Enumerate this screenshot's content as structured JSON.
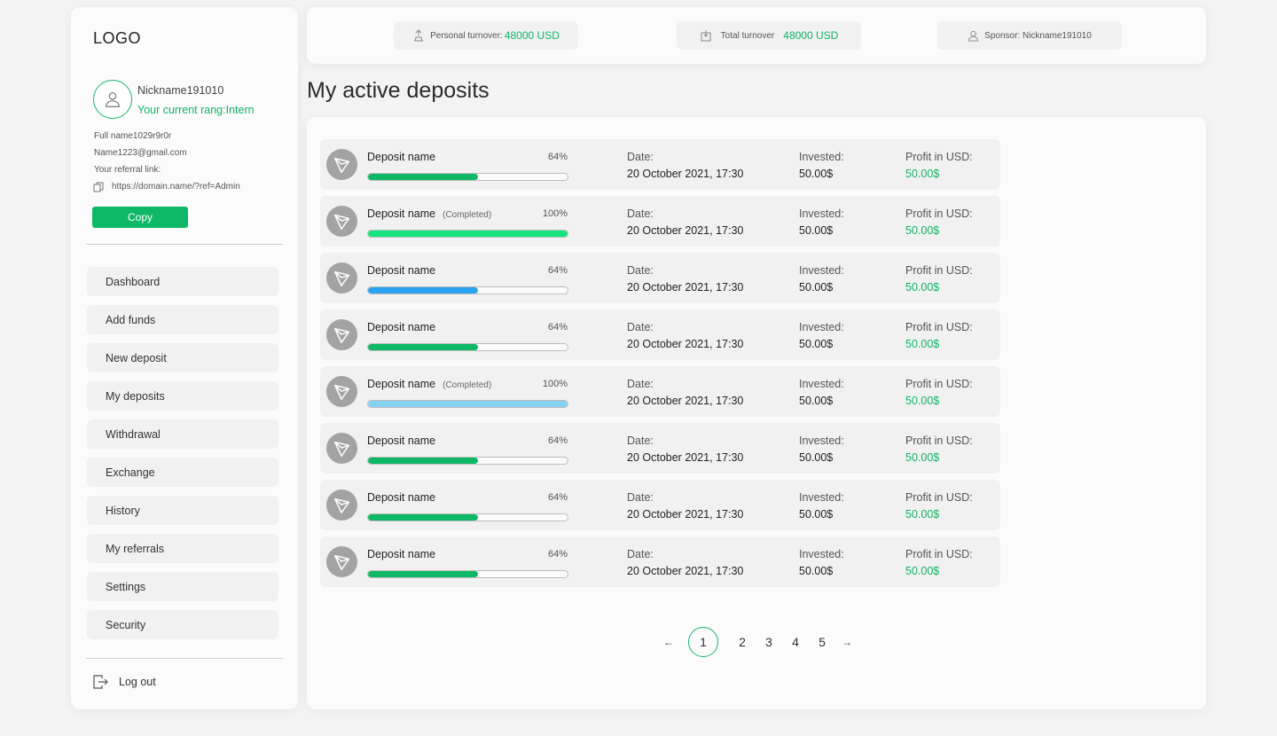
{
  "sidebar": {
    "logo": "LOGO",
    "nickname": "Nickname191010",
    "rang": "Your current rang:Intern",
    "full_name": "Full name1029r9r0r",
    "email": "Name1223@gmail.com",
    "referral_label": "Your referral link:",
    "referral_link": "https://domain.name/?ref=Admin",
    "copy_label": "Copy",
    "nav": [
      "Dashboard",
      "Add funds",
      "New deposit",
      "My deposits",
      "Withdrawal",
      "Exchange",
      "History",
      "My referrals",
      "Settings",
      "Security"
    ],
    "logout_label": "Log out"
  },
  "topbar": {
    "personal_label": "Personal turnover:",
    "personal_value": "48000 USD",
    "total_label": "Total turnover",
    "total_value": "48000 USD",
    "sponsor": "Sponsor: Nickname191010"
  },
  "page_title": "My active deposits",
  "deposits": [
    {
      "name": "Deposit name",
      "status": "",
      "percent_text": "64%",
      "progress": 0.55,
      "bar_color": "#0fb866",
      "date_label": "Date:",
      "date": "20 October 2021, 17:30",
      "invested_label": "Invested:",
      "invested": "50.00$",
      "profit_label": "Profit in USD:",
      "profit": "50.00$"
    },
    {
      "name": "Deposit name",
      "status": "(Completed)",
      "percent_text": "100%",
      "progress": 1.0,
      "bar_color": "#18e47f",
      "date_label": "Date:",
      "date": "20 October 2021, 17:30",
      "invested_label": "Invested:",
      "invested": "50.00$",
      "profit_label": "Profit in USD:",
      "profit": "50.00$"
    },
    {
      "name": "Deposit name",
      "status": "",
      "percent_text": "64%",
      "progress": 0.55,
      "bar_color": "#2aa3f0",
      "date_label": "Date:",
      "date": "20 October 2021, 17:30",
      "invested_label": "Invested:",
      "invested": "50.00$",
      "profit_label": "Profit in USD:",
      "profit": "50.00$"
    },
    {
      "name": "Deposit name",
      "status": "",
      "percent_text": "64%",
      "progress": 0.55,
      "bar_color": "#0fb866",
      "date_label": "Date:",
      "date": "20 October 2021, 17:30",
      "invested_label": "Invested:",
      "invested": "50.00$",
      "profit_label": "Profit in USD:",
      "profit": "50.00$"
    },
    {
      "name": "Deposit name",
      "status": "(Completed)",
      "percent_text": "100%",
      "progress": 1.0,
      "bar_color": "#86d2f5",
      "date_label": "Date:",
      "date": "20 October 2021, 17:30",
      "invested_label": "Invested:",
      "invested": "50.00$",
      "profit_label": "Profit in USD:",
      "profit": "50.00$"
    },
    {
      "name": "Deposit name",
      "status": "",
      "percent_text": "64%",
      "progress": 0.55,
      "bar_color": "#0fb866",
      "date_label": "Date:",
      "date": "20 October 2021, 17:30",
      "invested_label": "Invested:",
      "invested": "50.00$",
      "profit_label": "Profit in USD:",
      "profit": "50.00$"
    },
    {
      "name": "Deposit name",
      "status": "",
      "percent_text": "64%",
      "progress": 0.55,
      "bar_color": "#0fb866",
      "date_label": "Date:",
      "date": "20 October 2021, 17:30",
      "invested_label": "Invested:",
      "invested": "50.00$",
      "profit_label": "Profit in USD:",
      "profit": "50.00$"
    },
    {
      "name": "Deposit name",
      "status": "",
      "percent_text": "64%",
      "progress": 0.55,
      "bar_color": "#0fb866",
      "date_label": "Date:",
      "date": "20 October 2021, 17:30",
      "invested_label": "Invested:",
      "invested": "50.00$",
      "profit_label": "Profit in USD:",
      "profit": "50.00$"
    }
  ],
  "pagination": {
    "prev": "←",
    "current": "1",
    "pages": [
      "2",
      "3",
      "4",
      "5"
    ],
    "next": "→"
  },
  "colors": {
    "accent": "#0fb866",
    "background": "#f3f3f3",
    "card": "#fbfbfb"
  }
}
